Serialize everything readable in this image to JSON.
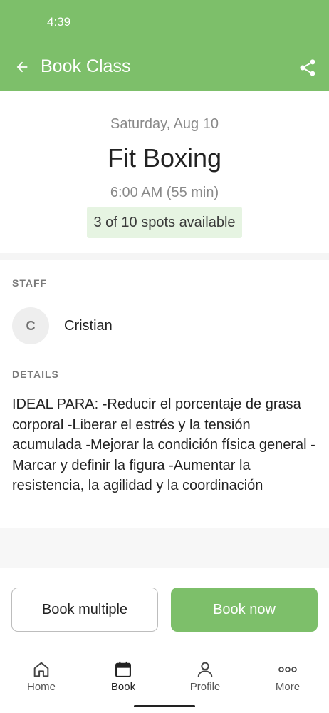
{
  "status_bar": {
    "time": "4:39"
  },
  "app_bar": {
    "title": "Book Class"
  },
  "class": {
    "date": "Saturday, Aug 10",
    "name": "Fit Boxing",
    "time": "6:00 AM (55 min)",
    "spots": "3 of 10 spots available"
  },
  "staff": {
    "label": "STAFF",
    "initial": "C",
    "name": "Cristian"
  },
  "details": {
    "label": "DETAILS",
    "text": "IDEAL PARA: -Reducir el porcentaje de grasa corporal -Liberar el estrés y la tensión acumulada -Mejorar la condición física general -Marcar y definir la figura -Aumentar la resistencia, la agilidad y la coordinación"
  },
  "actions": {
    "book_multiple": "Book multiple",
    "book_now": "Book now"
  },
  "bottom_nav": {
    "items": [
      {
        "label": "Home",
        "icon": "home-icon"
      },
      {
        "label": "Book",
        "icon": "calendar-icon",
        "active": true
      },
      {
        "label": "Profile",
        "icon": "person-icon"
      },
      {
        "label": "More",
        "icon": "more-dots-icon"
      }
    ]
  },
  "colors": {
    "brand": "#7dbf6a",
    "spots_badge_bg": "#e6f4e2"
  }
}
